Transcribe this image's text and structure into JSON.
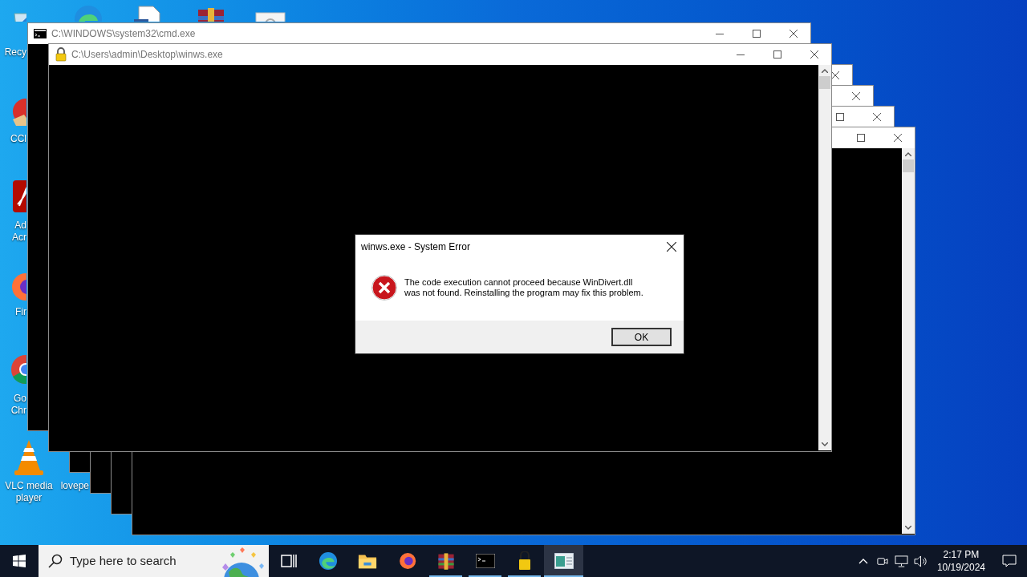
{
  "desktop_icons": [
    {
      "kind": "recycle-bin",
      "lines": [
        "Recy"
      ]
    },
    {
      "kind": "cleaner",
      "lines": [
        "CCl"
      ]
    },
    {
      "kind": "pdf",
      "lines": [
        "Ad",
        "Acr"
      ]
    },
    {
      "kind": "firefox",
      "lines": [
        "Fir"
      ]
    },
    {
      "kind": "chrome",
      "lines": [
        "Go",
        "Chr"
      ]
    },
    {
      "kind": "vlc",
      "lines": [
        "VLC media",
        "player"
      ]
    },
    {
      "kind": "none",
      "lines": [
        "lovepe"
      ]
    },
    {
      "kind": "edge"
    },
    {
      "kind": "document"
    },
    {
      "kind": "archive"
    },
    {
      "kind": "image"
    }
  ],
  "background_windows": [
    {
      "controls": [
        {
          "kind": "close"
        }
      ]
    },
    {
      "controls": [
        {
          "kind": "close"
        }
      ]
    },
    {
      "controls": [
        {
          "kind": "maximize"
        },
        {
          "kind": "close"
        }
      ]
    },
    {
      "controls": [
        {
          "kind": "maximize"
        },
        {
          "kind": "close"
        }
      ],
      "scrollbar": true
    }
  ],
  "windows": [
    {
      "kind": "console",
      "title": "C:\\WINDOWS\\system32\\cmd.exe"
    },
    {
      "kind": "locked",
      "title": "C:\\Users\\admin\\Desktop\\winws.exe",
      "scrollbar": true
    }
  ],
  "dialog": {
    "title": "winws.exe - System Error",
    "message": [
      "The code execution cannot proceed because WinDivert.dll",
      "was not found. Reinstalling the program may fix this problem."
    ],
    "button": "OK"
  },
  "taskbar": {
    "search": {
      "placeholder": "Type here to search"
    },
    "apps": [
      {
        "kind": "task-view",
        "running": false,
        "selected": false
      },
      {
        "kind": "edge",
        "running": false,
        "selected": false
      },
      {
        "kind": "folder",
        "running": false,
        "selected": false
      },
      {
        "kind": "firefox",
        "running": false,
        "selected": false
      },
      {
        "kind": "archive",
        "running": true,
        "selected": false
      },
      {
        "kind": "console",
        "running": true,
        "selected": false
      },
      {
        "kind": "lock",
        "running": true,
        "selected": false
      },
      {
        "kind": "app-window",
        "running": true,
        "selected": true
      }
    ],
    "clock": {
      "time": "2:17 PM",
      "date": "10/19/2024"
    }
  }
}
